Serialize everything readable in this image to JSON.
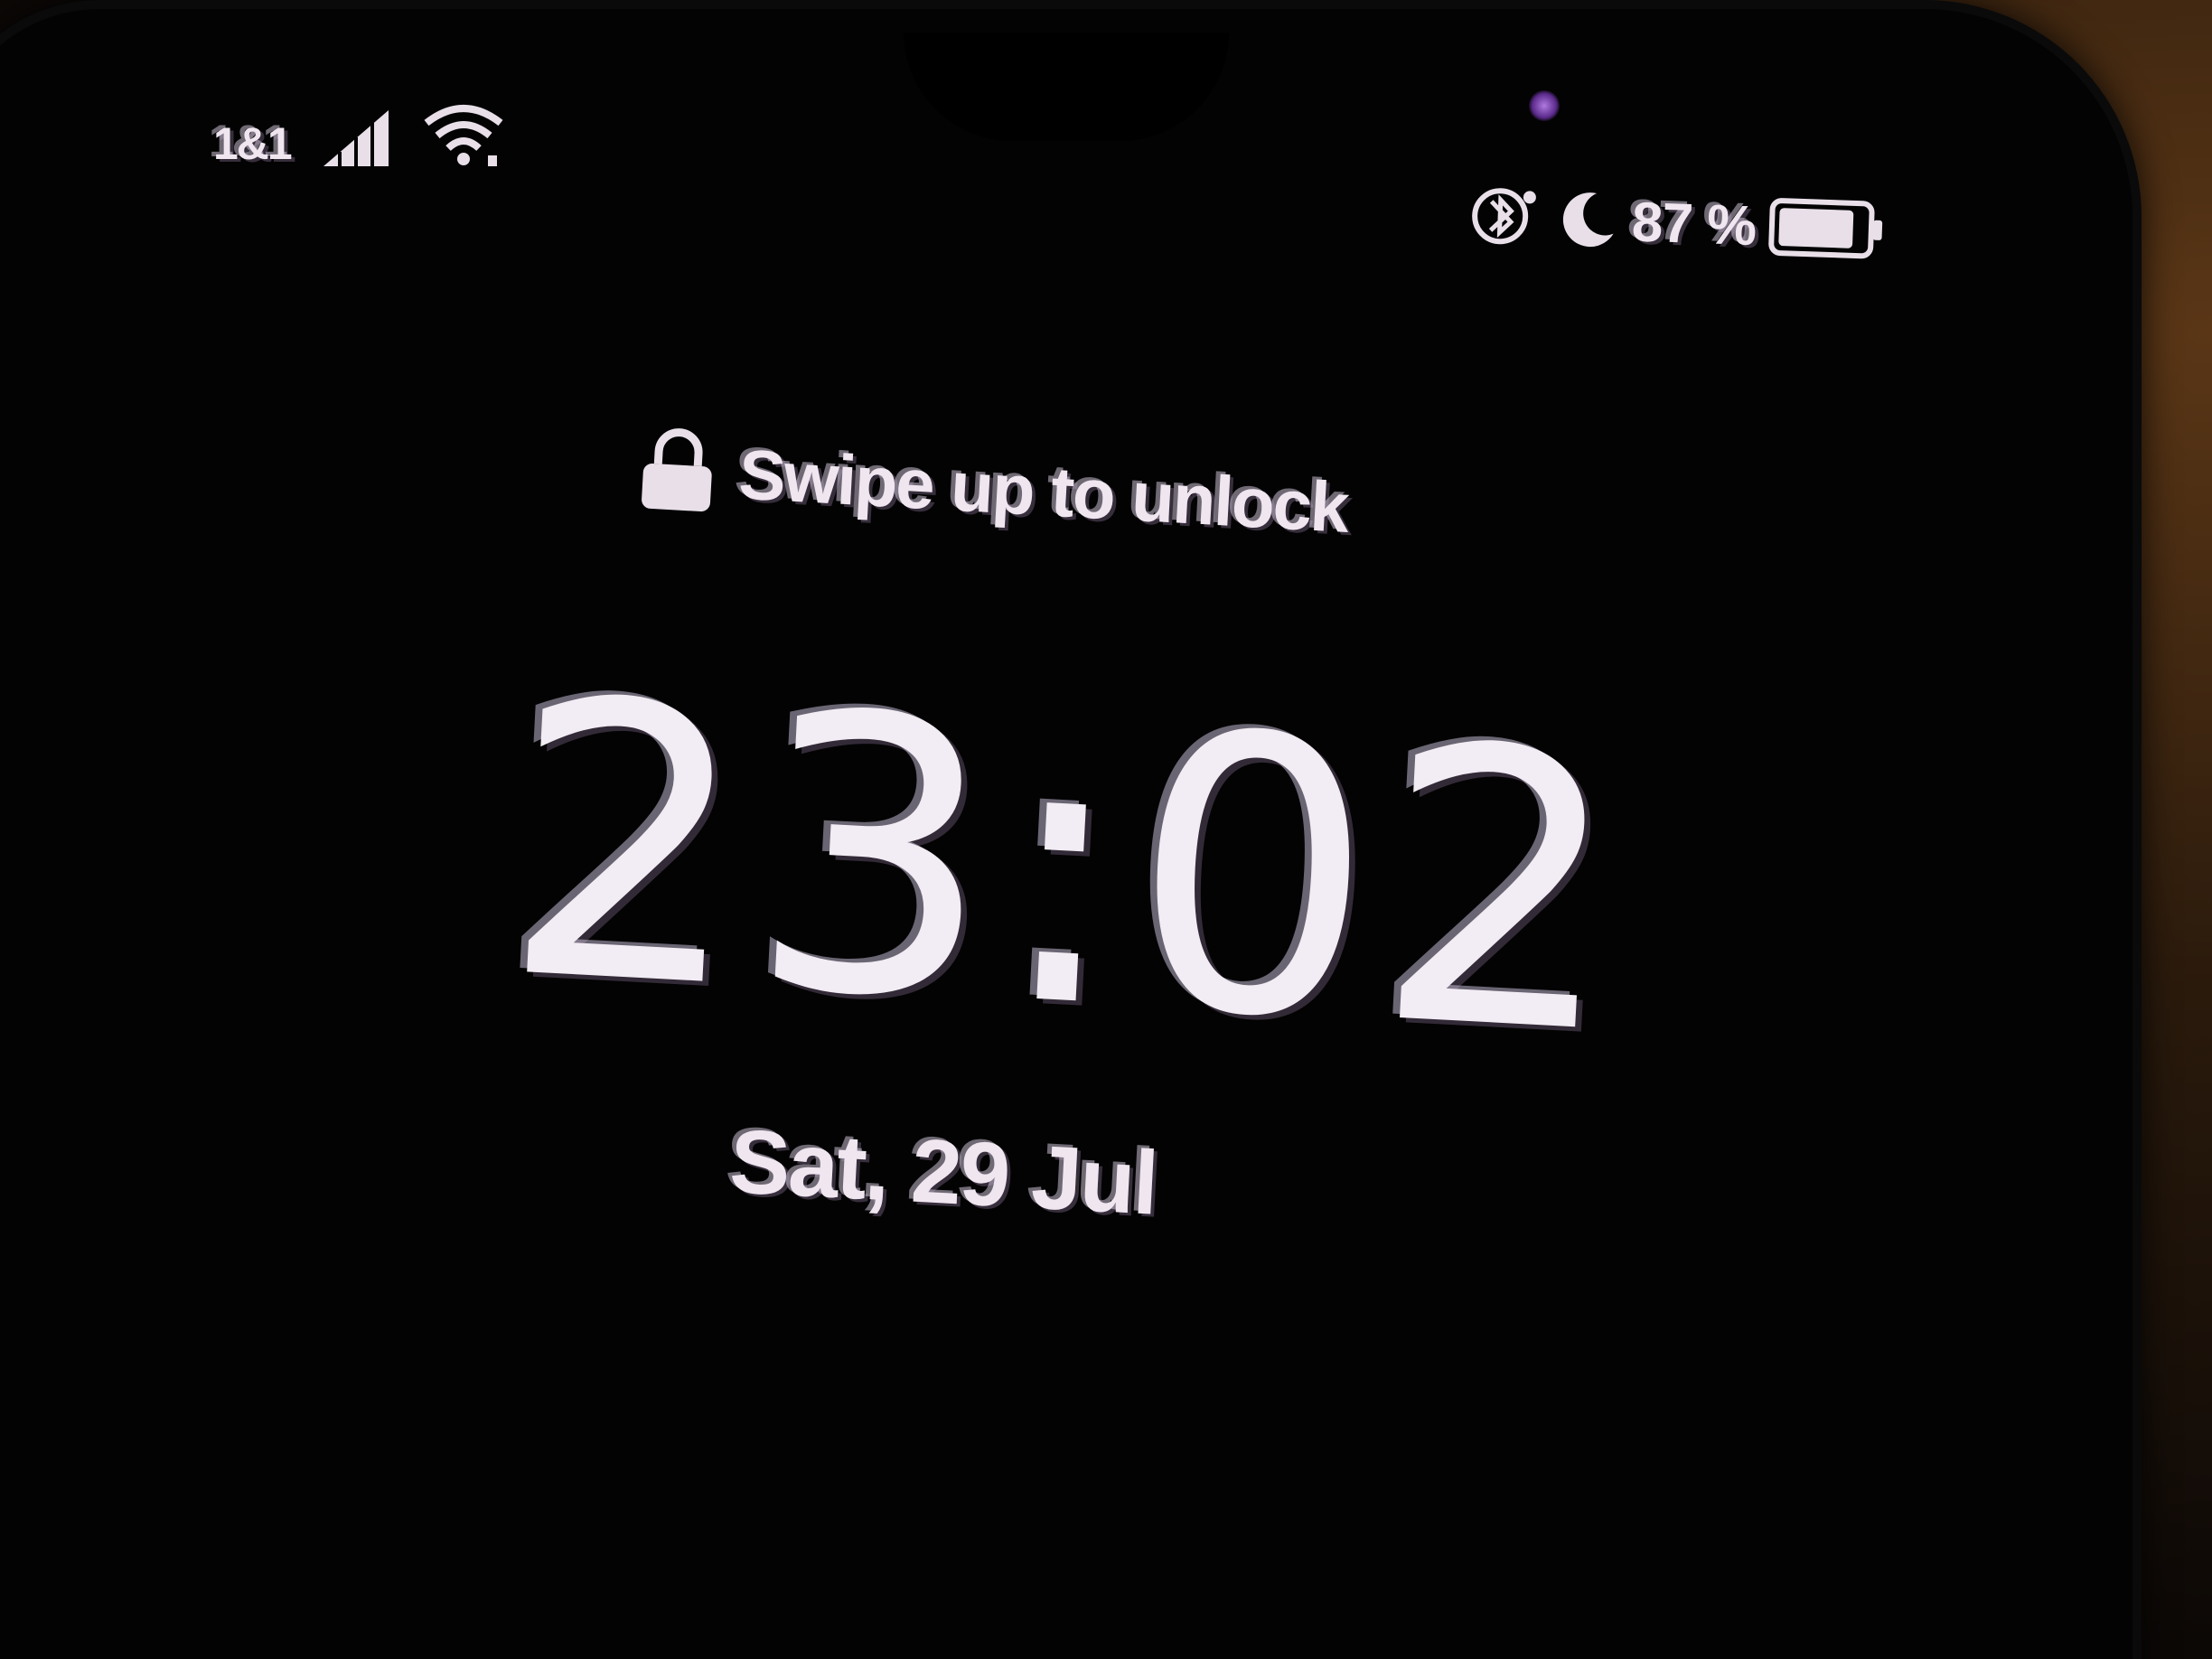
{
  "status_bar": {
    "carrier": "1&1",
    "signal_icon": "cellular-signal-icon",
    "wifi_icon": "wifi-icon",
    "bluetooth_icon": "bluetooth-icon",
    "dnd_icon": "moon-icon",
    "battery_percent": "87 %",
    "battery_level": 0.87
  },
  "lockscreen": {
    "hint": "Swipe up to unlock",
    "lock_icon": "lock-icon",
    "time": "23:02",
    "date": "Sat, 29 Jul"
  },
  "colors": {
    "text": "#efe6f0",
    "screen_bg": "#030303",
    "camera_tint": "#8a4ac0"
  }
}
